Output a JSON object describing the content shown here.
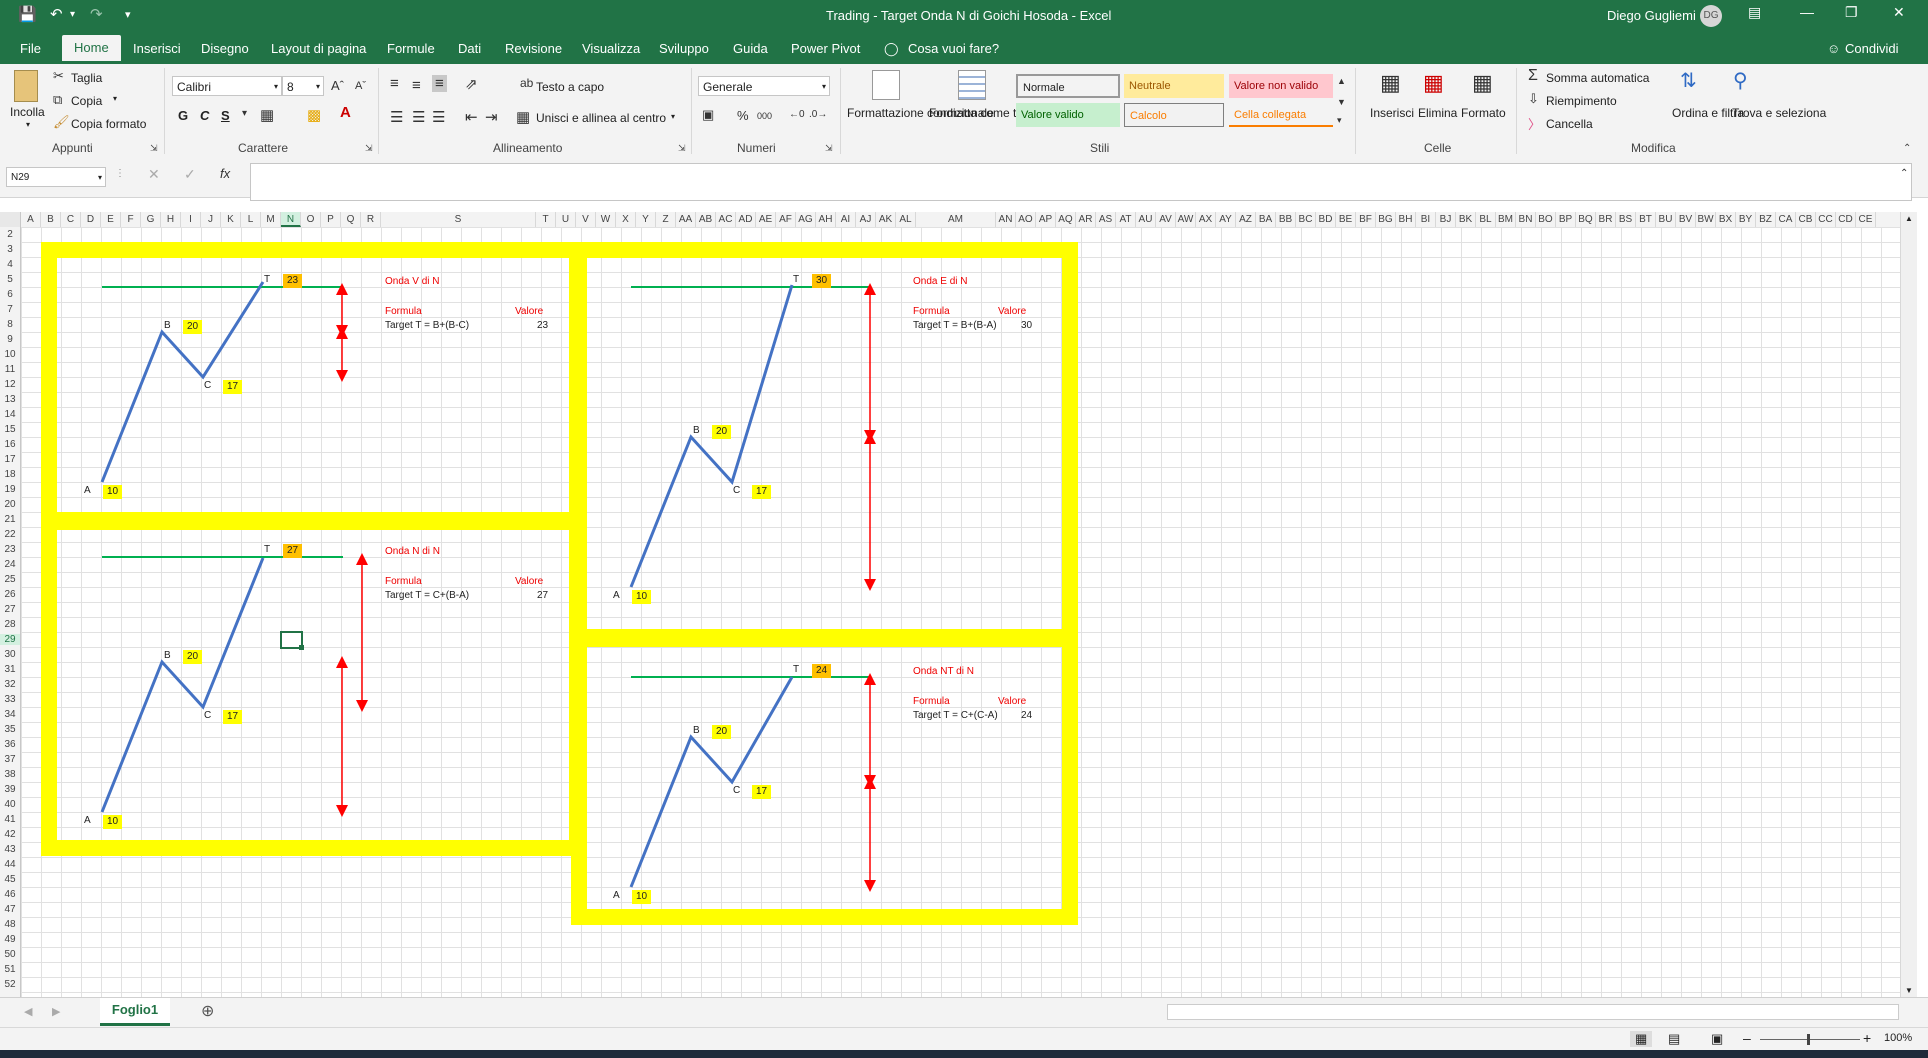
{
  "titlebar": {
    "title": "Trading - Target Onda N di Goichi Hosoda  -  Excel",
    "user": "Diego Gugliemi",
    "initials": "DG"
  },
  "menu": [
    "File",
    "Home",
    "Inserisci",
    "Disegno",
    "Layout di pagina",
    "Formule",
    "Dati",
    "Revisione",
    "Visualizza",
    "Sviluppo",
    "Guida",
    "Power Pivot"
  ],
  "tell_me": "Cosa vuoi fare?",
  "share": "Condividi",
  "ribbon": {
    "appunti": {
      "paste": "Incolla",
      "cut": "Taglia",
      "copy": "Copia",
      "format_painter": "Copia formato",
      "group": "Appunti"
    },
    "carattere": {
      "font": "Calibri",
      "size": "8",
      "bold": "G",
      "italic": "C",
      "underline": "S",
      "group": "Carattere"
    },
    "allineamento": {
      "wrap": "Testo a capo",
      "merge": "Unisci e allinea al centro",
      "group": "Allineamento"
    },
    "numeri": {
      "format": "Generale",
      "group": "Numeri"
    },
    "stili": {
      "cond_format": "Formattazione condizionale",
      "table_format": "Formatta come tabella",
      "group": "Stili",
      "styles": [
        {
          "label": "Normale",
          "bg": "#ffffff",
          "fg": "#000000"
        },
        {
          "label": "Neutrale",
          "bg": "#ffeb9c",
          "fg": "#9c5700"
        },
        {
          "label": "Valore non valido",
          "bg": "#ffc7ce",
          "fg": "#9c0006"
        },
        {
          "label": "Valore valido",
          "bg": "#c6efce",
          "fg": "#006100"
        },
        {
          "label": "Calcolo",
          "bg": "#f2f2f2",
          "fg": "#fa7d00"
        },
        {
          "label": "Cella collegata",
          "bg": "#ffffff",
          "fg": "#fa7d00"
        }
      ]
    },
    "celle": {
      "insert": "Inserisci",
      "delete": "Elimina",
      "format": "Formato",
      "group": "Celle"
    },
    "modifica": {
      "autosum": "Somma automatica",
      "fill": "Riempimento",
      "clear": "Cancella",
      "sort": "Ordina e filtra",
      "find": "Trova e seleziona",
      "group": "Modifica"
    }
  },
  "formula_bar": {
    "name_box": "N29",
    "formula": ""
  },
  "columns": [
    "A",
    "B",
    "C",
    "D",
    "E",
    "F",
    "G",
    "H",
    "I",
    "J",
    "K",
    "L",
    "M",
    "N",
    "O",
    "P",
    "Q",
    "R",
    "S",
    "T",
    "U",
    "V",
    "W",
    "X",
    "Y",
    "Z",
    "AA",
    "AB",
    "AC",
    "AD",
    "AE",
    "AF",
    "AG",
    "AH",
    "AI",
    "AJ",
    "AK",
    "AL",
    "AM",
    "AN",
    "AO",
    "AP",
    "AQ",
    "AR",
    "AS",
    "AT",
    "AU",
    "AV",
    "AW",
    "AX",
    "AY",
    "AZ",
    "BA",
    "BB",
    "BC",
    "BD",
    "BE",
    "BF",
    "BG",
    "BH",
    "BI",
    "BJ",
    "BK",
    "BL",
    "BM",
    "BN",
    "BO",
    "BP",
    "BQ",
    "BR",
    "BS",
    "BT",
    "BU",
    "BV",
    "BW",
    "BX",
    "BY",
    "BZ",
    "CA",
    "CB",
    "CC",
    "CD",
    "CE"
  ],
  "rows": [
    "2",
    "3",
    "4",
    "5",
    "6",
    "7",
    "8",
    "9",
    "10",
    "11",
    "12",
    "13",
    "14",
    "15",
    "16",
    "17",
    "18",
    "19",
    "20",
    "21",
    "22",
    "23",
    "24",
    "25",
    "26",
    "27",
    "28",
    "29",
    "30",
    "31",
    "32",
    "33",
    "34",
    "35",
    "36",
    "37",
    "38",
    "39",
    "40",
    "41",
    "42",
    "43",
    "44",
    "45",
    "46",
    "47",
    "48",
    "49",
    "50",
    "51",
    "52"
  ],
  "panels": [
    {
      "title": "Onda V di N",
      "formula_header": "Formula",
      "value_header": "Valore",
      "formula": "Target T = B+(B-C)",
      "result": "23",
      "A": "10",
      "B": "20",
      "C": "17",
      "T": "23",
      "labels": {
        "a": "A",
        "b": "B",
        "c": "C",
        "t": "T"
      }
    },
    {
      "title": "Onda N di N",
      "formula_header": "Formula",
      "value_header": "Valore",
      "formula": "Target T = C+(B-A)",
      "result": "27",
      "A": "10",
      "B": "20",
      "C": "17",
      "T": "27",
      "labels": {
        "a": "A",
        "b": "B",
        "c": "C",
        "t": "T"
      }
    },
    {
      "title": "Onda E di N",
      "formula_header": "Formula",
      "value_header": "Valore",
      "formula": "Target T = B+(B-A)",
      "result": "30",
      "A": "10",
      "B": "20",
      "C": "17",
      "T": "30",
      "labels": {
        "a": "A",
        "b": "B",
        "c": "C",
        "t": "T"
      }
    },
    {
      "title": "Onda NT di N",
      "formula_header": "Formula",
      "value_header": "Valore",
      "formula": "Target T = C+(C-A)",
      "result": "24",
      "A": "10",
      "B": "20",
      "C": "17",
      "T": "24",
      "labels": {
        "a": "A",
        "b": "B",
        "c": "C",
        "t": "T"
      }
    }
  ],
  "sheet_tab": "Foglio1",
  "zoom": "100%",
  "colors": {
    "excel_green": "#217346",
    "panel_yellow": "#ffff00",
    "highlight_orange": "#ffc000",
    "line_blue": "#4472c4",
    "target_green": "#00b050",
    "arrow_red": "#ff0000"
  }
}
